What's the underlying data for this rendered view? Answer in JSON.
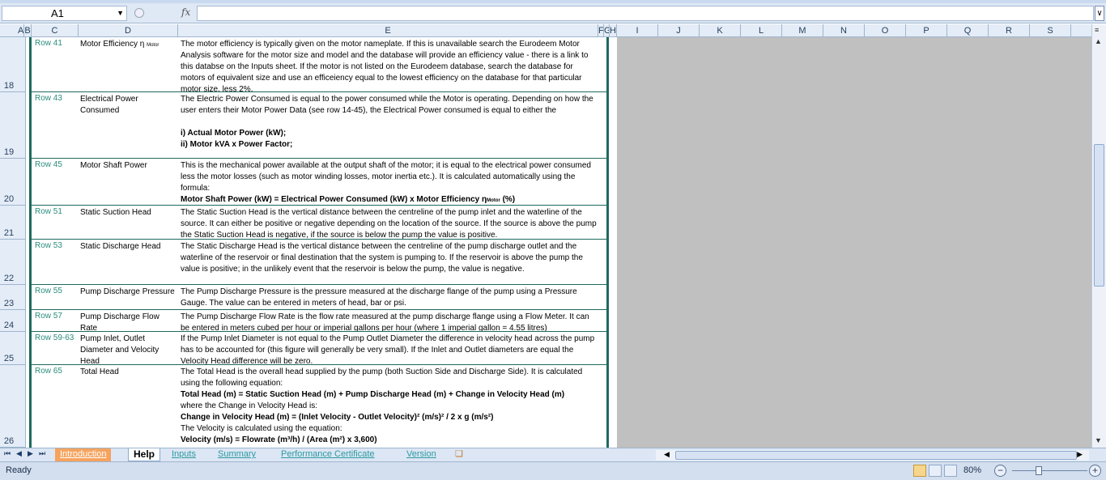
{
  "formula_bar": {
    "name_box": "A1",
    "fx_symbol": "fx",
    "formula": ""
  },
  "columns": [
    "A",
    "B",
    "C",
    "D",
    "E",
    "F",
    "G",
    "H",
    "I",
    "J",
    "K",
    "L",
    "M",
    "N",
    "O",
    "P",
    "Q",
    "R",
    "S"
  ],
  "rows": [
    "18",
    "19",
    "20",
    "21",
    "22",
    "23",
    "24",
    "25",
    "26"
  ],
  "entries": [
    {
      "row_ref": "Row 41",
      "label": "Motor Efficiency η",
      "label_sub": "Motor",
      "description": "The motor efficiency is typically given on the motor nameplate.  If this is unavailable search the Eurodeem Motor Analysis software for the motor size and model and the database will provide an efficiency value - there is a link to this databse on the Inputs sheet.  If the motor is not listed on the Eurodeem database, search the database for motors of equivalent size and use an efficeiency equal to the lowest efficiency on the database for that particular motor size, less 2%."
    },
    {
      "row_ref": "Row 43",
      "label": "Electrical Power Consumed",
      "description": "The  Electric Power Consumed is equal to the power consumed while the Motor is operating.  Depending on how the user enters their Motor Power Data (see row 14-45), the Electrical Power consumed is equal to either the",
      "bold_line_1": "i) Actual Motor Power (kW);",
      "bold_line_2": "ii) Motor kVA x Power Factor;"
    },
    {
      "row_ref": "Row 45",
      "label": "Motor Shaft Power",
      "description": "This is the mechanical power available at the output shaft of the motor; it is equal to the electrical power consumed less the motor losses (such as motor winding losses, motor inertia etc.).  It is calculated automatically using the formula:",
      "bold_line_1": "Motor Shaft Power (kW) = Electrical Power Consumed (kW) x Motor Efficiency η",
      "bold_sub": "Motor",
      "bold_tail": " (%)"
    },
    {
      "row_ref": "Row 51",
      "label": "Static Suction Head",
      "description": "The Static Suction Head is the vertical distance between the centreline of the pump inlet and the waterline of the source.  It can either be positive or negative depending on the location of the source.  If the source is above the pump the Static Suction Head is negative, if the source is below the pump the value is positive."
    },
    {
      "row_ref": "Row  53",
      "label": "Static Discharge Head",
      "description": "The Static Discharge Head is the vertical distance between the centreline of the pump discharge outlet and the waterline of the reservoir or final destination that the system is pumping to.  If the reservoir is above the pump the value is positive; in the unlikely event that the reservoir is below the pump, the value is negative."
    },
    {
      "row_ref": "Row 55",
      "label": "Pump Discharge Pressure",
      "description": "The Pump Discharge Pressure is the pressure measured at the discharge flange of the pump using a Pressure Gauge.  The value can be entered in meters of head, bar or psi."
    },
    {
      "row_ref": "Row 57",
      "label": "Pump Discharge Flow Rate",
      "description": "The Pump Discharge Flow Rate is the flow rate measured at the pump discharge flange using a Flow Meter.  It can be entered in meters cubed per hour or imperial gallons per hour (where 1 imperial gallon = 4.55 litres)"
    },
    {
      "row_ref": "Row 59-63",
      "label": "Pump Inlet, Outlet Diameter and Velocity Head",
      "description": "If the Pump Inlet Diameter is not equal to the Pump Outlet Diameter the difference in velocity head across the pump has to be accounted for (this figure will generally be very small).  If the Inlet and Outlet diameters are equal the Velocity Head difference will be zero."
    },
    {
      "row_ref": "Row 65",
      "label": "Total Head",
      "description": "The Total Head is the overall head supplied by the pump (both Suction Side and Discharge Side).  It is calculated using the following equation:",
      "bold_line_1": "Total Head (m) = Static Suction Head (m) + Pump Discharge Head (m) + Change in Velocity Head (m)",
      "line_2": "where the Change in Velocity Head is:",
      "bold_line_3": "Change in Velocity Head (m)  = (Inlet Velocity - Outlet Velocity)² (m/s)² / 2 x g (m/s²)",
      "line_4": "The Velocity is calculated using the equation:",
      "bold_line_5": "Velocity (m/s) = Flowrate (m³/h) / (Area (m²) x 3,600)"
    }
  ],
  "tabs": [
    "Introduction",
    "Help",
    "Inputs",
    "Summary",
    "Performance Certificate",
    "Version"
  ],
  "active_tab": "Help",
  "status": {
    "ready": "Ready",
    "zoom": "80%",
    "zoom_out": "−",
    "zoom_in": "+"
  },
  "colors": {
    "accent_teal": "#1f6a5e",
    "row_ref_text": "#2a8c7c",
    "tab_orange": "#f5a35e"
  }
}
